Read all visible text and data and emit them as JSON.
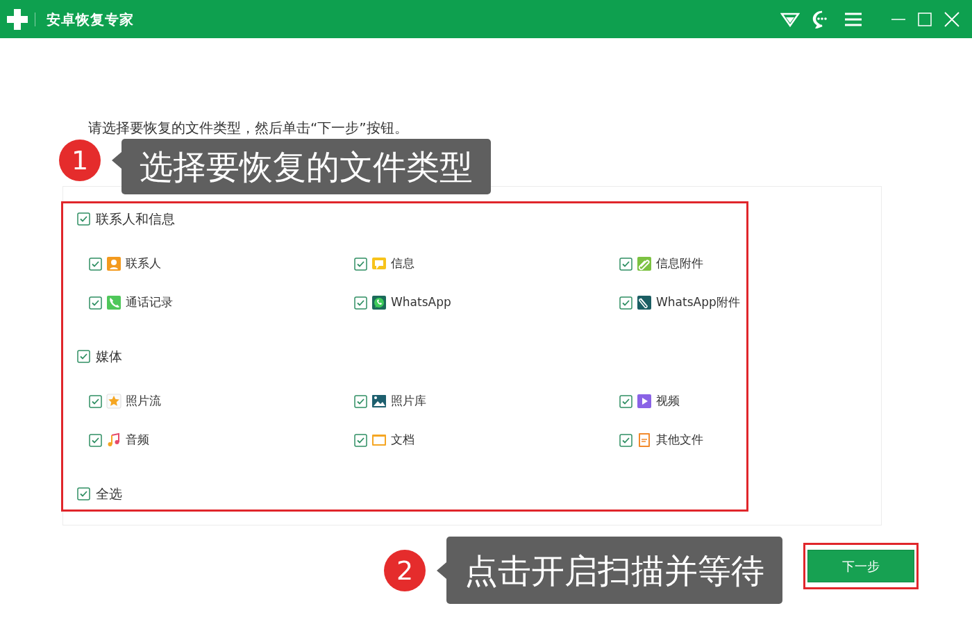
{
  "window": {
    "title": "安卓恢复专家"
  },
  "instruction": "请选择要恢复的文件类型，然后单击“下一步”按钮。",
  "groups": [
    {
      "label": "联系人和信息",
      "checked": true,
      "items": [
        {
          "label": "联系人",
          "checked": true,
          "kind": "contact"
        },
        {
          "label": "信息",
          "checked": true,
          "kind": "message"
        },
        {
          "label": "信息附件",
          "checked": true,
          "kind": "attachment"
        },
        {
          "label": "通话记录",
          "checked": true,
          "kind": "calls"
        },
        {
          "label": "WhatsApp",
          "checked": true,
          "kind": "whatsapp"
        },
        {
          "label": "WhatsApp附件",
          "checked": true,
          "kind": "whatsapp-attachment"
        }
      ]
    },
    {
      "label": "媒体",
      "checked": true,
      "items": [
        {
          "label": "照片流",
          "checked": true,
          "kind": "photostream"
        },
        {
          "label": "照片库",
          "checked": true,
          "kind": "gallery"
        },
        {
          "label": "视频",
          "checked": true,
          "kind": "video"
        },
        {
          "label": "音频",
          "checked": true,
          "kind": "audio"
        },
        {
          "label": "文档",
          "checked": true,
          "kind": "document"
        },
        {
          "label": "其他文件",
          "checked": true,
          "kind": "other"
        }
      ]
    }
  ],
  "select_all": {
    "label": "全选",
    "checked": true
  },
  "callouts": [
    {
      "number": "1",
      "text": "选择要恢复的文件类型"
    },
    {
      "number": "2",
      "text": "点击开启扫描并等待"
    }
  ],
  "next_button": "下一步"
}
